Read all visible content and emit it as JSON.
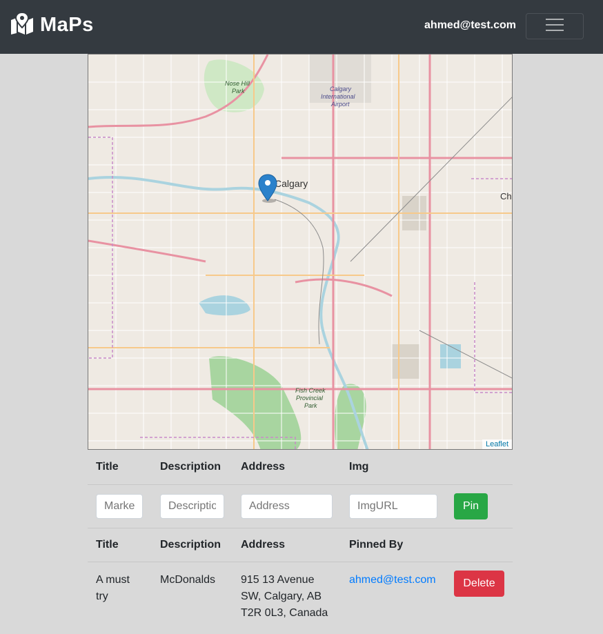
{
  "navbar": {
    "brand": "MaPs",
    "user_email": "ahmed@test.com",
    "brand_icon": "map-marked-icon",
    "toggler_icon": "hamburger-icon"
  },
  "map": {
    "attribution": "Leaflet",
    "labels": {
      "city": "Calgary",
      "city_partial": "Ch",
      "park1": "Nose Hill",
      "park1b": "Park",
      "airport1": "Calgary",
      "airport2": "International",
      "airport3": "Airport",
      "park2": "Fish Creek",
      "park2b": "Provincial",
      "park2c": "Park"
    }
  },
  "form_table": {
    "headers": [
      "Title",
      "Description",
      "Address",
      "Img"
    ],
    "placeholders": {
      "title": "Marker",
      "description": "Description",
      "address": "Address",
      "img": "ImgURL"
    },
    "pin_label": "Pin"
  },
  "list_table": {
    "headers": [
      "Title",
      "Description",
      "Address",
      "Pinned By"
    ],
    "rows": [
      {
        "title": "A must try",
        "description": "McDonalds",
        "address": "915 13 Avenue SW, Calgary, AB T2R 0L3, Canada",
        "pinned_by": "ahmed@test.com",
        "delete_label": "Delete"
      }
    ]
  },
  "colors": {
    "navbar": "#343a40",
    "pin_button": "#28a745",
    "delete_button": "#dc3545",
    "link": "#007bff",
    "map_marker": "#2a81cb"
  }
}
